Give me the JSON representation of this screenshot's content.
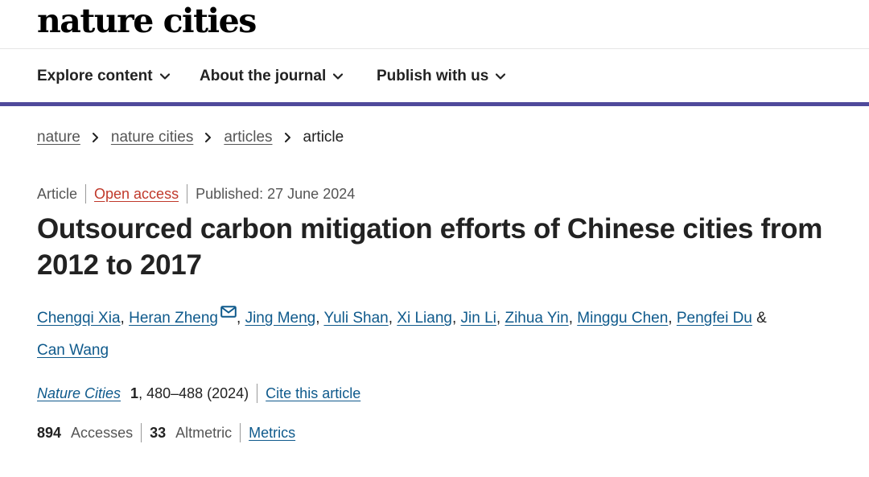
{
  "brand": {
    "logo_text": "nature cities"
  },
  "nav": {
    "items": [
      {
        "label": "Explore content"
      },
      {
        "label": "About the journal"
      },
      {
        "label": "Publish with us"
      }
    ]
  },
  "breadcrumb": {
    "items": [
      "nature",
      "nature cities",
      "articles"
    ],
    "current": "article"
  },
  "article": {
    "type": "Article",
    "access": "Open access",
    "published": "Published: 27 June 2024",
    "title": "Outsourced carbon mitigation efforts of Chinese cities from 2012 to 2017",
    "authors": [
      "Chengqi Xia",
      "Heran Zheng",
      "Jing Meng",
      "Yuli Shan",
      "Xi Liang",
      "Jin Li",
      "Zihua Yin",
      "Minggu Chen",
      "Pengfei Du",
      "Can Wang"
    ],
    "author_separator": ", ",
    "author_final_separator": " &",
    "journal": "Nature Cities",
    "volume": "1",
    "pages_year": ", 480–488 (2024)",
    "cite_label": "Cite this article"
  },
  "metrics": {
    "accesses_value": "894",
    "accesses_label": "Accesses",
    "altmetric_value": "33",
    "altmetric_label": "Altmetric",
    "metrics_link": "Metrics"
  },
  "colors": {
    "accent_rule": "#4f4a9b",
    "link": "#0f5a8c",
    "open_access": "#c0392b"
  }
}
